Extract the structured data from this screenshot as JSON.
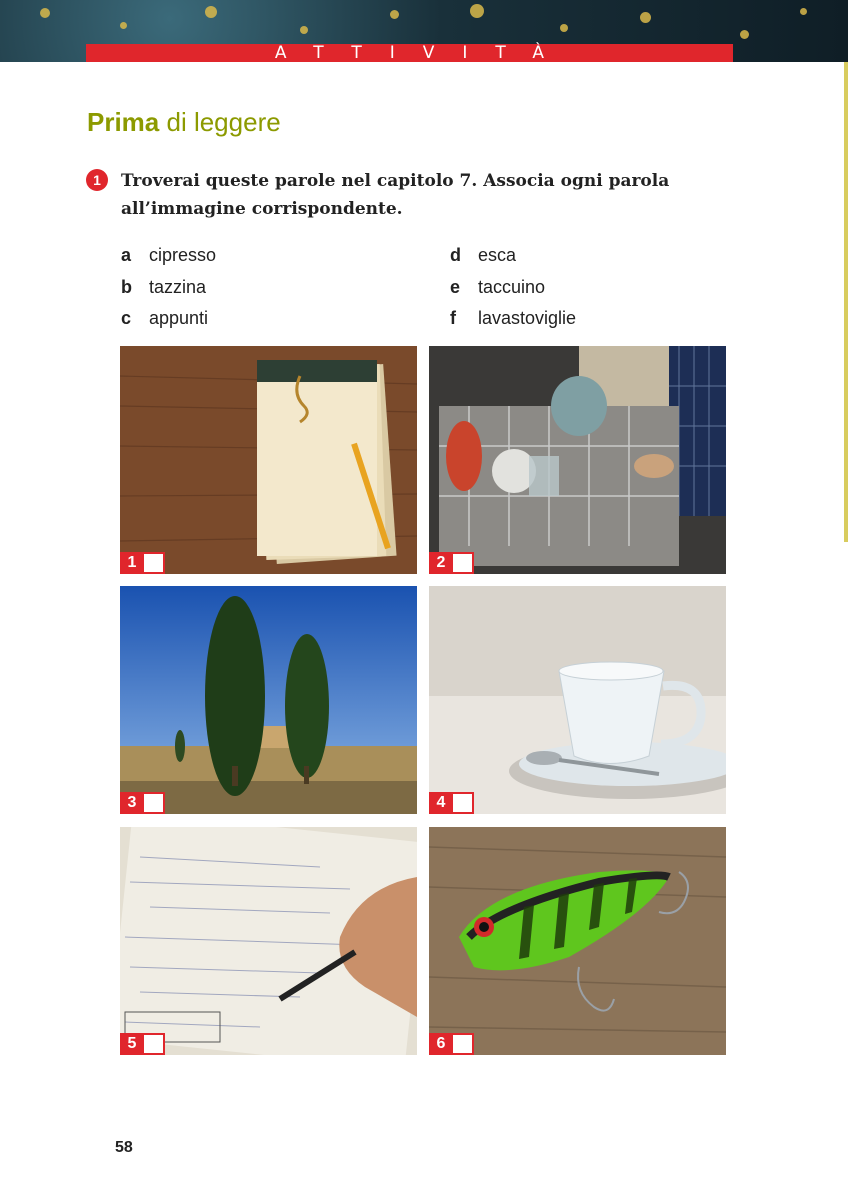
{
  "banner": {
    "label": "ATTIVITÀ"
  },
  "section": {
    "title_bold": "Prima",
    "title_rest": " di leggere"
  },
  "exercise": {
    "number": "1",
    "instruction": "Troverai queste parole nel capitolo 7. Associa ogni parola all’immagine corrispondente.",
    "words_col1": [
      {
        "letter": "a",
        "word": "cipresso"
      },
      {
        "letter": "b",
        "word": "tazzina"
      },
      {
        "letter": "c",
        "word": "appunti"
      }
    ],
    "words_col2": [
      {
        "letter": "d",
        "word": "esca"
      },
      {
        "letter": "e",
        "word": "taccuino"
      },
      {
        "letter": "f",
        "word": "lavastoviglie"
      }
    ]
  },
  "photos": [
    {
      "number": "1",
      "icon": "notepad-pencil-photo"
    },
    {
      "number": "2",
      "icon": "dishwasher-photo"
    },
    {
      "number": "3",
      "icon": "cypress-trees-photo"
    },
    {
      "number": "4",
      "icon": "cup-saucer-photo"
    },
    {
      "number": "5",
      "icon": "handwritten-notes-photo"
    },
    {
      "number": "6",
      "icon": "fishing-lure-photo"
    }
  ],
  "page": {
    "number": "58"
  },
  "colors": {
    "accent_red": "#e0262c",
    "title_olive": "#8c9a00"
  }
}
